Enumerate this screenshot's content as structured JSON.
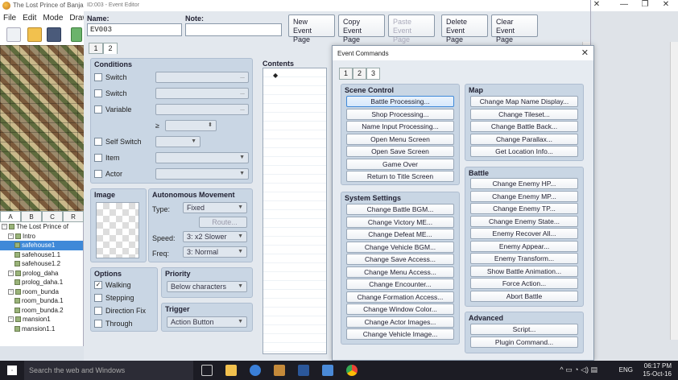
{
  "main": {
    "title": "The Lost Prince of Banjar -",
    "menu": [
      "File",
      "Edit",
      "Mode",
      "Draw"
    ],
    "tileset_tabs": [
      "A",
      "B",
      "C",
      "R"
    ],
    "tree": [
      {
        "label": "The Lost Prince of",
        "level": 0,
        "exp": "−"
      },
      {
        "label": "Intro",
        "level": 1,
        "exp": "−"
      },
      {
        "label": "safehouse1",
        "level": 2,
        "selected": true
      },
      {
        "label": "safehouse1.1",
        "level": 2
      },
      {
        "label": "safehouse1.2",
        "level": 2
      },
      {
        "label": "prolog_daha",
        "level": 1,
        "exp": "−"
      },
      {
        "label": "prolog_daha.1",
        "level": 2
      },
      {
        "label": "room_bunda",
        "level": 1,
        "exp": "−"
      },
      {
        "label": "room_bunda.1",
        "level": 2
      },
      {
        "label": "room_bunda.2",
        "level": 2
      },
      {
        "label": "mansion1",
        "level": 1,
        "exp": "−"
      },
      {
        "label": "mansion1.1",
        "level": 2
      }
    ]
  },
  "event_editor": {
    "title": "ID:003 - Event Editor",
    "name_label": "Name:",
    "name_value": "EV003",
    "note_label": "Note:",
    "note_value": "",
    "buttons": [
      {
        "line1": "New",
        "line2": "Event Page",
        "disabled": false
      },
      {
        "line1": "Copy",
        "line2": "Event Page",
        "disabled": false
      },
      {
        "line1": "Paste",
        "line2": "Event Page",
        "disabled": true
      },
      {
        "line1": "Delete",
        "line2": "Event Page",
        "disabled": false
      },
      {
        "line1": "Clear",
        "line2": "Event Page",
        "disabled": false
      }
    ],
    "page_tabs": [
      "1",
      "2"
    ],
    "conditions": {
      "header": "Conditions",
      "switch1": "Switch",
      "switch2": "Switch",
      "variable": "Variable",
      "gte": "≥",
      "self_switch": "Self Switch",
      "item": "Item",
      "actor": "Actor",
      "ellipsis": "..."
    },
    "image_header": "Image",
    "autonomous": {
      "header": "Autonomous Movement",
      "type_label": "Type:",
      "type_value": "Fixed",
      "route_label": "Route...",
      "speed_label": "Speed:",
      "speed_value": "3: x2 Slower",
      "freq_label": "Freq:",
      "freq_value": "3: Normal"
    },
    "options": {
      "header": "Options",
      "walking": "Walking",
      "stepping": "Stepping",
      "direction_fix": "Direction Fix",
      "through": "Through",
      "check": "✓"
    },
    "priority": {
      "header": "Priority",
      "value": "Below characters"
    },
    "trigger": {
      "header": "Trigger",
      "value": "Action Button"
    },
    "contents_header": "Contents",
    "contents_marker": "◆"
  },
  "event_commands": {
    "title": "Event Commands",
    "close": "✕",
    "tabs": [
      "1",
      "2",
      "3"
    ],
    "scene_control": {
      "header": "Scene Control",
      "items": [
        "Battle Processing...",
        "Shop Processing...",
        "Name Input Processing...",
        "Open Menu Screen",
        "Open Save Screen",
        "Game Over",
        "Return to Title Screen"
      ]
    },
    "system_settings": {
      "header": "System Settings",
      "items": [
        "Change Battle BGM...",
        "Change Victory ME...",
        "Change Defeat ME...",
        "Change Vehicle BGM...",
        "Change Save Access...",
        "Change Menu Access...",
        "Change Encounter...",
        "Change Formation Access...",
        "Change Window Color...",
        "Change Actor Images...",
        "Change Vehicle Image..."
      ]
    },
    "map": {
      "header": "Map",
      "items": [
        "Change Map Name Display...",
        "Change Tileset...",
        "Change Battle Back...",
        "Change Parallax...",
        "Get Location Info..."
      ]
    },
    "battle": {
      "header": "Battle",
      "items": [
        "Change Enemy HP...",
        "Change Enemy MP...",
        "Change Enemy TP...",
        "Change Enemy State...",
        "Enemy Recover All...",
        "Enemy Appear...",
        "Enemy Transform...",
        "Show Battle Animation...",
        "Force Action...",
        "Abort Battle"
      ]
    },
    "advanced": {
      "header": "Advanced",
      "items": [
        "Script...",
        "Plugin Command..."
      ]
    }
  },
  "taskbar": {
    "search_placeholder": "Search the web and Windows",
    "time": "06:17 PM",
    "date": "15-Oct-16",
    "lang": "ENG"
  },
  "colors": {
    "selected_blue": "#3f89d8",
    "panel_blue": "#c9d6e4",
    "taskbar": "#1c1c24"
  }
}
